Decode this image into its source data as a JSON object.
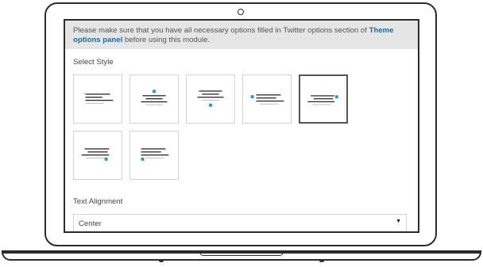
{
  "notice": {
    "text_before": "Please make sure that you have all necessary options filled in Twitter options section of ",
    "link_text": "Theme options panel",
    "text_after": " before using this module."
  },
  "select_style": {
    "label": "Select Style",
    "options_count": 7,
    "selected_index": 5
  },
  "text_alignment": {
    "label": "Text Alignment",
    "value": "Center",
    "arrow_icon": "dropdown-arrow-icon"
  },
  "colors": {
    "accent": "#1a9cc6",
    "link": "#1f6b92",
    "notice_bg": "#e5e5e5",
    "frame": "#2b2b2b"
  }
}
